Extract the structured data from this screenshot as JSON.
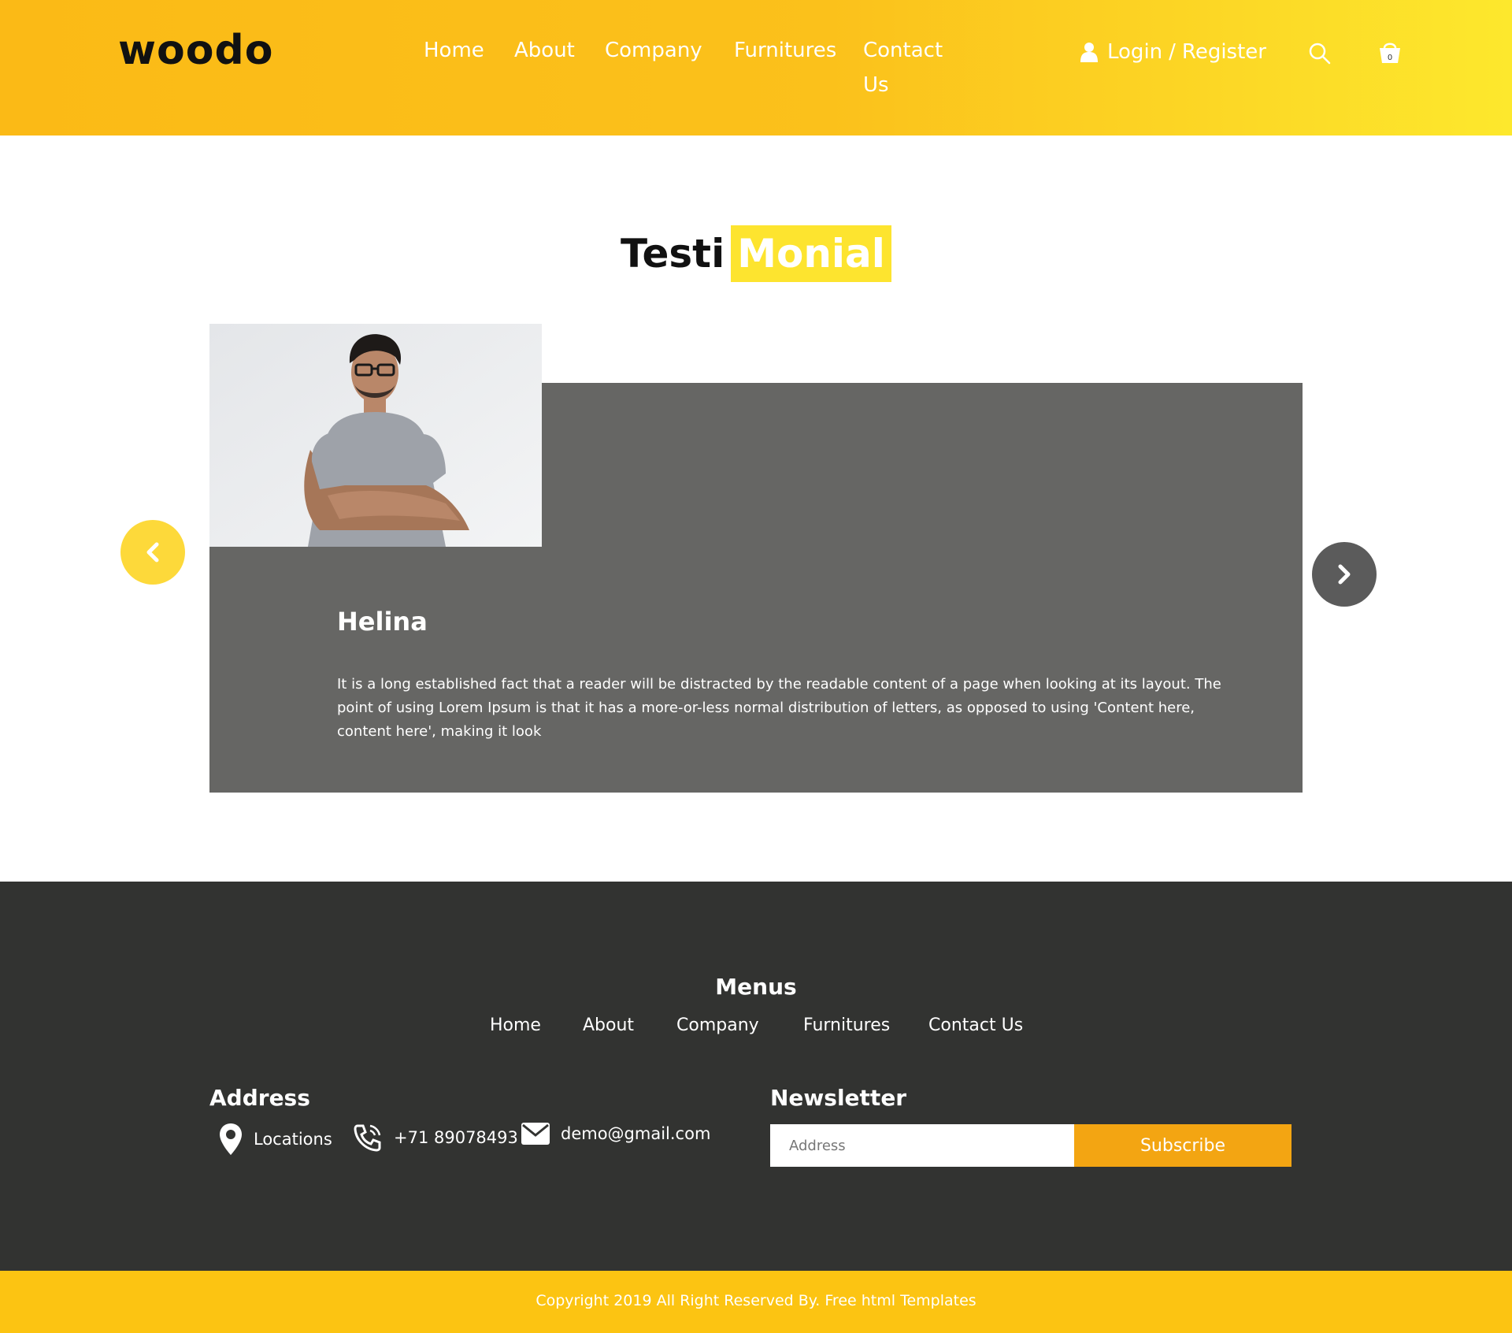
{
  "header": {
    "logo": "woodo",
    "nav": [
      {
        "label": "Home"
      },
      {
        "label": "About"
      },
      {
        "label": "Company"
      },
      {
        "label": "Furnitures"
      },
      {
        "label": "Contact Us"
      }
    ],
    "login_label": "Login",
    "separator": "/",
    "register_label": "Register",
    "cart_count": "0"
  },
  "testimonial": {
    "title_part1": "Testi",
    "title_part2": "Monial",
    "name": "Helina",
    "quote": "It is a long established fact that a reader will be distracted by the readable content of a page when looking at its layout. The point of using Lorem Ipsum is that it has a more-or-less normal distribution of letters, as opposed to using 'Content here, content here', making it look"
  },
  "footer": {
    "menus_title": "Menus",
    "menu_links": [
      {
        "label": "Home"
      },
      {
        "label": "About"
      },
      {
        "label": "Company"
      },
      {
        "label": "Furnitures"
      },
      {
        "label": "Contact Us"
      }
    ],
    "address_title": "Address",
    "location": "Locations",
    "phone": "+71 89078493",
    "email": "demo@gmail.com",
    "newsletter_title": "Newsletter",
    "newsletter_placeholder": "Address",
    "subscribe_label": "Subscribe",
    "copyright": "Copyright 2019 All Right Reserved By. Free html Templates"
  },
  "colors": {
    "header_yellow": "#fbba16",
    "title_highlight": "#fde42f",
    "card_gray": "#666664",
    "footer_dark": "#323331",
    "subscribe_orange": "#f3a512",
    "copyright_yellow": "#fcc412"
  },
  "icons": [
    "user-icon",
    "search-icon",
    "cart-icon",
    "chevron-left-icon",
    "chevron-right-icon",
    "location-pin-icon",
    "phone-icon",
    "envelope-icon"
  ]
}
